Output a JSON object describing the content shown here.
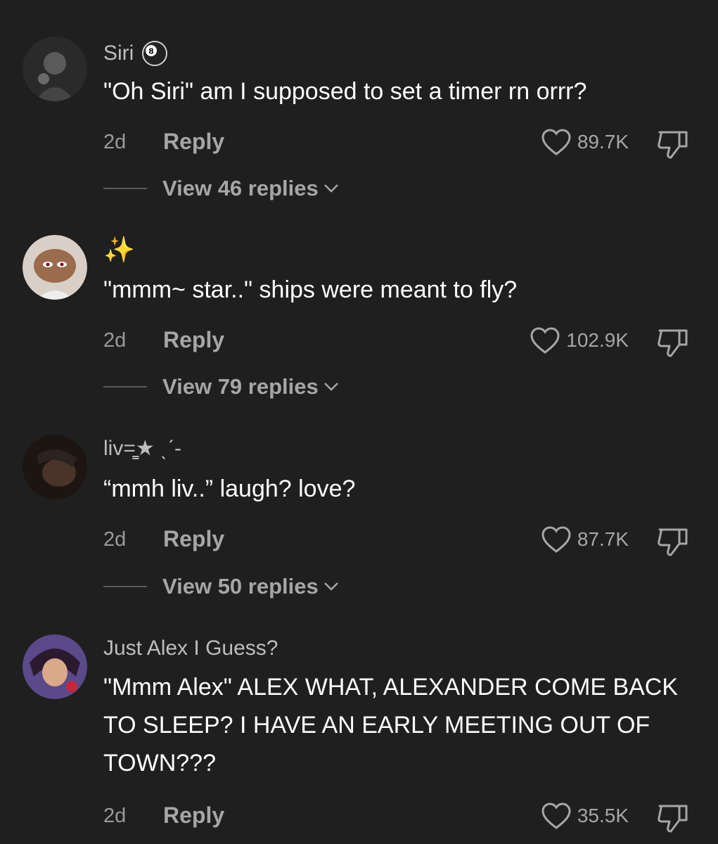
{
  "comments": [
    {
      "username": "Siri",
      "username_icon": "8-ball-icon",
      "text": "\"Oh Siri\" am I supposed to set a timer rn orrr?",
      "time": "2d",
      "reply_label": "Reply",
      "likes": "89.7K",
      "view_replies": "View 46 replies"
    },
    {
      "username": "",
      "username_icon": "sparkles-icon",
      "username_glyph": "✨",
      "text": "\"mmm~ star..\" ships were meant to fly?",
      "time": "2d",
      "reply_label": "Reply",
      "likes": "102.9K",
      "view_replies": "View 79 replies"
    },
    {
      "username": "liv=̳̳★ ˎˊ-",
      "text": "“mmh liv..” laugh? love?",
      "time": "2d",
      "reply_label": "Reply",
      "likes": "87.7K",
      "view_replies": "View 50 replies"
    },
    {
      "username": "Just Alex I Guess?",
      "text": "\"Mmm Alex\" ALEX WHAT, ALEXANDER COME BACK TO SLEEP? I HAVE AN EARLY MEETING OUT OF TOWN???",
      "time": "2d",
      "reply_label": "Reply",
      "likes": "35.5K"
    }
  ],
  "colors": {
    "background": "#1f1f1f",
    "text": "#ffffff",
    "muted": "#a6a6a6",
    "sparkle": "#f6c745"
  }
}
